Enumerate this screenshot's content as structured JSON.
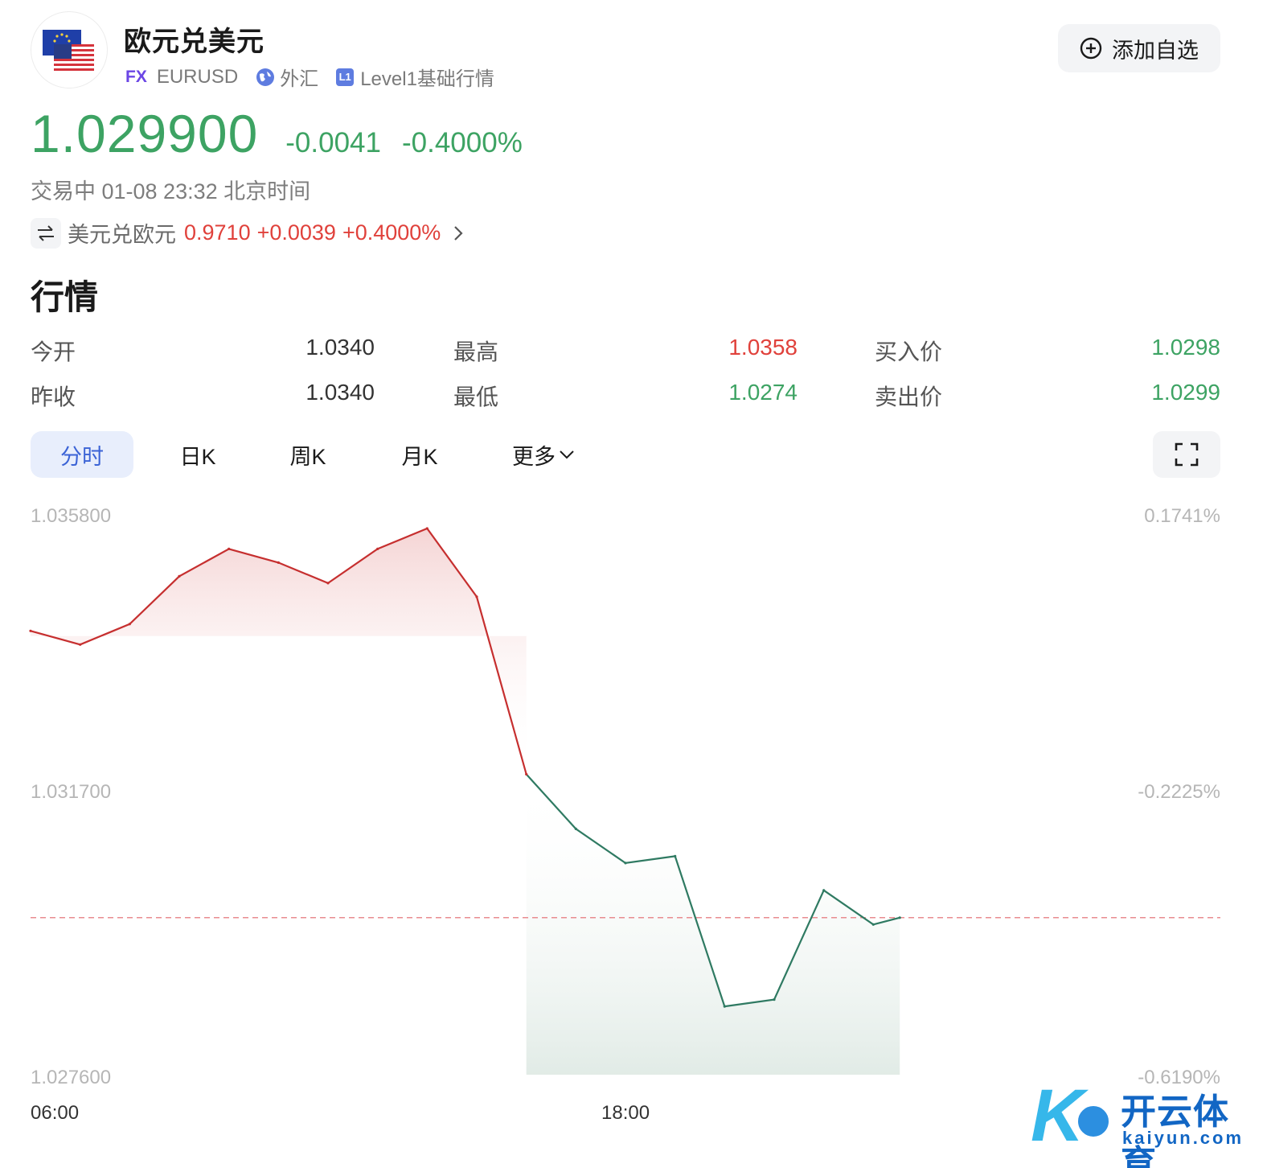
{
  "header": {
    "title": "欧元兑美元",
    "fx_badge": "FX",
    "symbol": "EURUSD",
    "category": "外汇",
    "level_badge": "L1",
    "level_label": "Level1基础行情",
    "watch_button": "添加自选"
  },
  "price": {
    "last": "1.029900",
    "change": "-0.0041",
    "change_pct": "-0.4000%",
    "status": "交易中 01-08 23:32 北京时间"
  },
  "inverse": {
    "label": "美元兑欧元",
    "value": "0.9710",
    "change": "+0.0039",
    "change_pct": "+0.4000%"
  },
  "section_title": "行情",
  "quotes": {
    "open_label": "今开",
    "open": "1.0340",
    "prev_label": "昨收",
    "prev": "1.0340",
    "high_label": "最高",
    "high": "1.0358",
    "low_label": "最低",
    "low": "1.0274",
    "bid_label": "买入价",
    "bid": "1.0298",
    "ask_label": "卖出价",
    "ask": "1.0299"
  },
  "tabs": [
    {
      "label": "分时",
      "active": true
    },
    {
      "label": "日K"
    },
    {
      "label": "周K"
    },
    {
      "label": "月K"
    },
    {
      "label": "更多"
    }
  ],
  "colors": {
    "up": "#e0413b",
    "down": "#3da363",
    "line_up": "#c62f2f",
    "line_down": "#2f7a62",
    "accent": "#3b63d6"
  },
  "chart_data": {
    "type": "line",
    "y_ticks_left": [
      "1.035800",
      "1.031700",
      "1.027600"
    ],
    "y_ticks_right": [
      "0.1741%",
      "-0.2225%",
      "-0.6190%"
    ],
    "x_ticks": [
      "06:00",
      "18:00"
    ],
    "ylim": [
      1.0276,
      1.0358
    ],
    "baseline": 1.0299,
    "series": [
      {
        "x": [
          "06:00",
          "07:00",
          "08:00",
          "09:00",
          "10:00",
          "11:00",
          "12:00",
          "13:00",
          "14:00",
          "15:00",
          "16:00",
          "17:00",
          "18:00",
          "19:00",
          "20:00",
          "21:00",
          "22:00",
          "23:00",
          "23:32"
        ],
        "values": [
          1.0341,
          1.0339,
          1.0342,
          1.0349,
          1.0353,
          1.0351,
          1.0348,
          1.0353,
          1.0356,
          1.0346,
          1.032,
          1.0312,
          1.0307,
          1.0308,
          1.0286,
          1.0287,
          1.0303,
          1.0298,
          1.0299
        ]
      }
    ]
  },
  "watermark": {
    "cn": "开云体育",
    "en": "kaiyun.com"
  }
}
